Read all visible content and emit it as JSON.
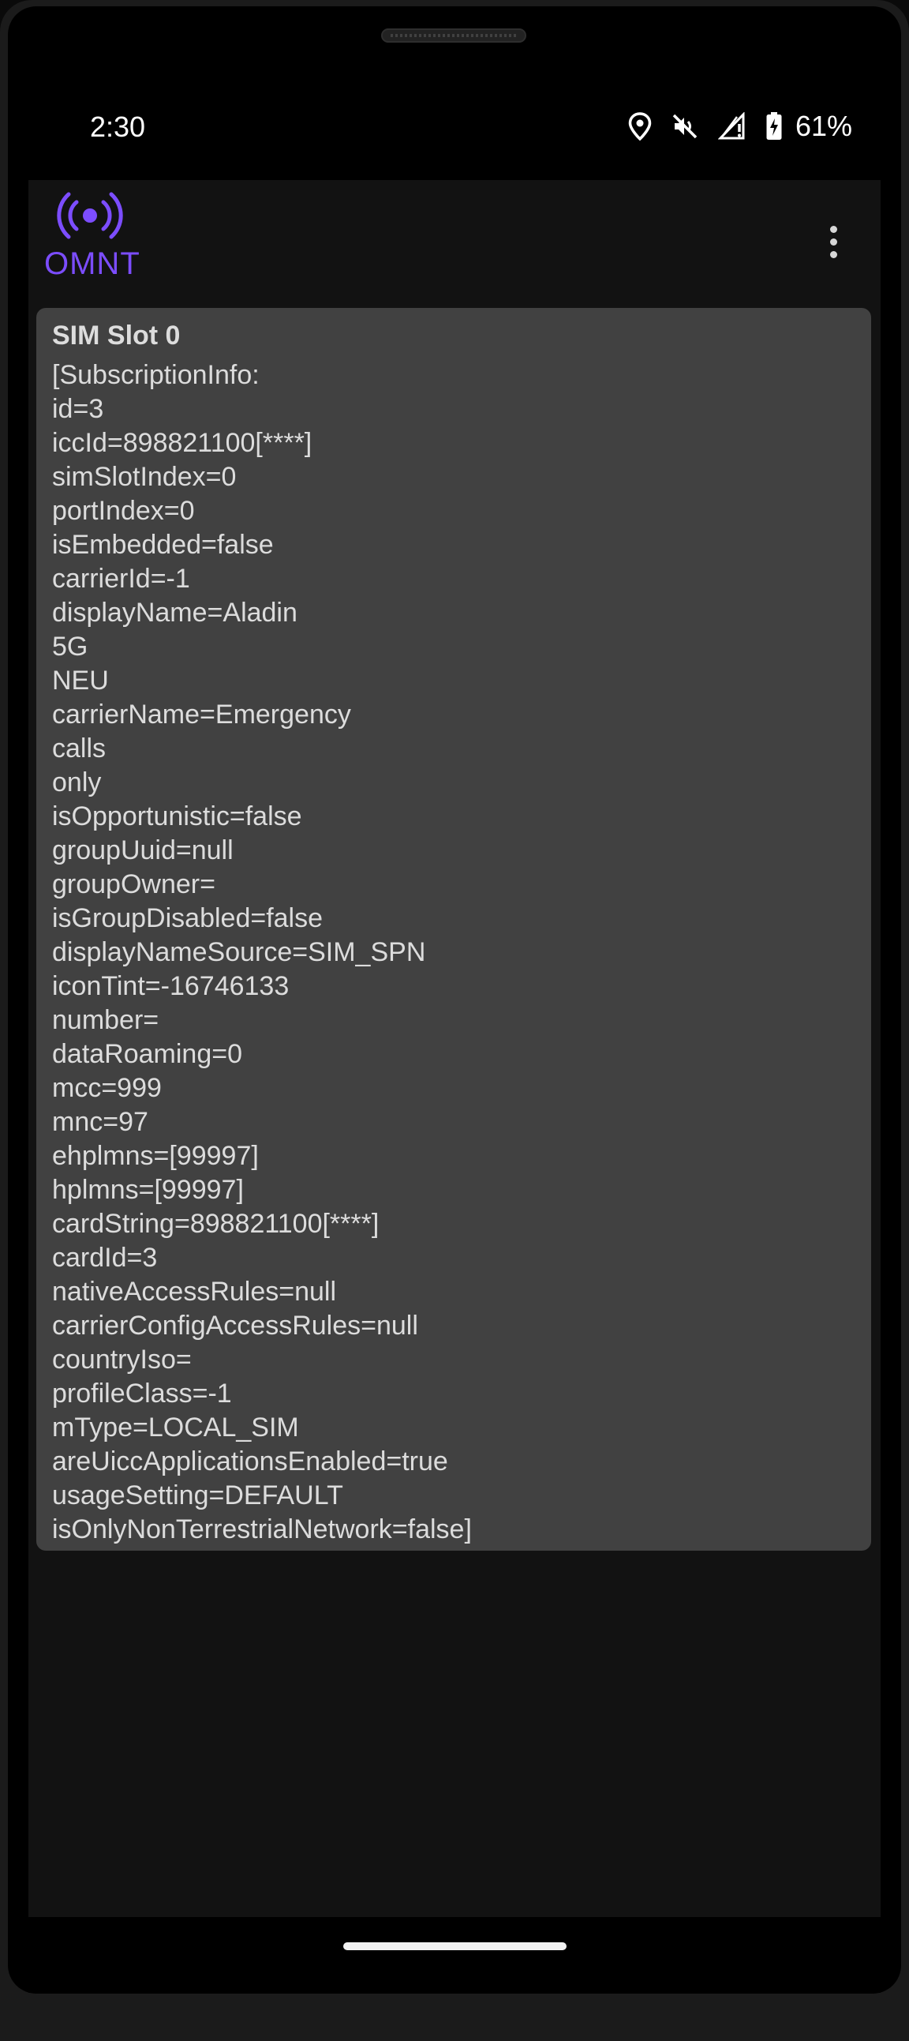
{
  "status_bar": {
    "time": "2:30",
    "battery": "61%",
    "icons": [
      "location-icon",
      "vibrate-off-icon",
      "signal-no-service-icon",
      "battery-charging-icon"
    ]
  },
  "app_bar": {
    "logo_text": "OMNT",
    "menu_icon": "more-vert-icon",
    "accent_color": "#7c4dff"
  },
  "card": {
    "title": "SIM Slot 0",
    "lines": [
      "[SubscriptionInfo:",
      "id=3",
      "iccId=898821100[****]",
      "simSlotIndex=0",
      "portIndex=0",
      "isEmbedded=false",
      "carrierId=-1",
      "displayName=Aladin",
      "5G",
      "NEU",
      "carrierName=Emergency",
      "calls",
      "only",
      "isOpportunistic=false",
      "groupUuid=null",
      "groupOwner=",
      "isGroupDisabled=false",
      "displayNameSource=SIM_SPN",
      "iconTint=-16746133",
      "number=",
      "dataRoaming=0",
      "mcc=999",
      "mnc=97",
      "ehplmns=[99997]",
      "hplmns=[99997]",
      "cardString=898821100[****]",
      "cardId=3",
      "nativeAccessRules=null",
      "carrierConfigAccessRules=null",
      "countryIso=",
      "profileClass=-1",
      "mType=LOCAL_SIM",
      "areUiccApplicationsEnabled=true",
      "usageSetting=DEFAULT",
      "isOnlyNonTerrestrialNetwork=false]"
    ]
  }
}
